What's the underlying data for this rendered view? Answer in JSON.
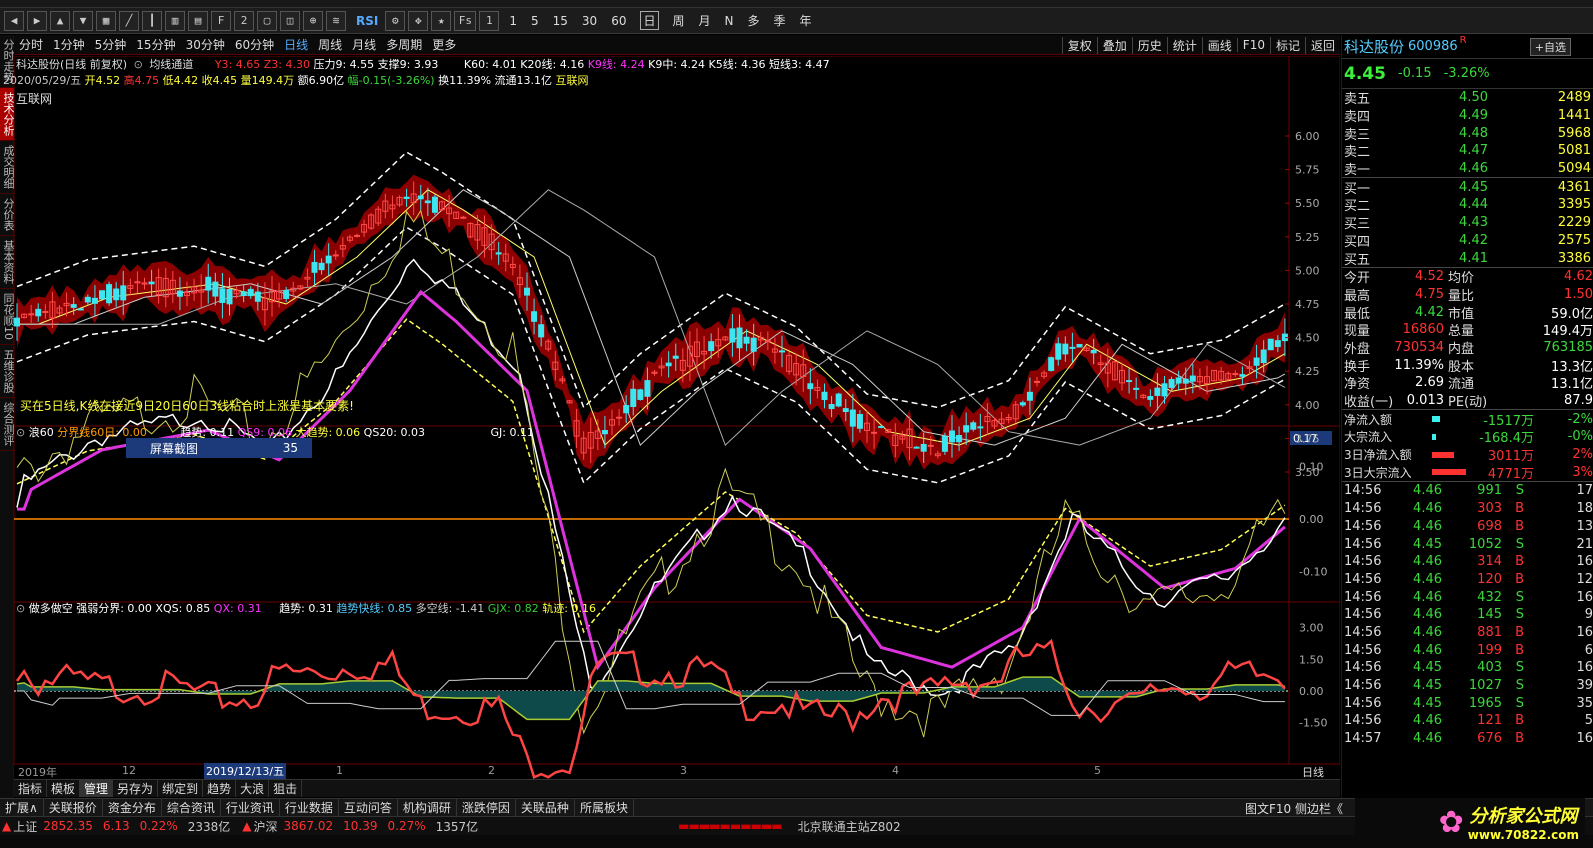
{
  "toolbar": {
    "periods": [
      "1",
      "5",
      "15",
      "30",
      "60"
    ],
    "day_tabs": [
      "日",
      "周",
      "月",
      "N",
      "多",
      "季",
      "年"
    ],
    "rsi": "RSI",
    "fs": "Fs"
  },
  "tabs": {
    "items": [
      "分时",
      "1分钟",
      "5分钟",
      "15分钟",
      "30分钟",
      "60分钟",
      "日线",
      "周线",
      "月线",
      "多周期",
      "更多"
    ],
    "active": "日线",
    "right": [
      "复权",
      "叠加",
      "历史",
      "统计",
      "画线",
      "F10",
      "标记",
      "返回"
    ]
  },
  "left_tabs": [
    "分时走势",
    "技术分析",
    "成交明细",
    "分价表",
    "基本资料",
    "同花顺10",
    "五维诊股",
    "综合测评"
  ],
  "main": {
    "title": "科达股份(日线 前复权)",
    "indicator_name": "均线通道",
    "y3": "Y3: 4.65",
    "z3": "Z3: 4.30",
    "yali": "压力9: 4.55",
    "zhicheng": "支撑9: 3.93",
    "k60": "K60: 4.01",
    "k20": "K20线: 4.16",
    "k9": "K9线: 4.24",
    "k9z": "K9中: 4.24",
    "k5": "K5线: 4.36",
    "dx": "短线3: 4.47",
    "date": "2020/05/29/五",
    "open": "开4.52",
    "high": "高4.75",
    "low": "低4.42",
    "close": "收4.45",
    "vol": "量149.4万",
    "amt": "额6.90亿",
    "chg": "幅-0.15(-3.26%)",
    "turn": "换11.39%",
    "flow": "流通13.1亿",
    "sector": "互联网",
    "label_net": "互联网",
    "note": "买在5日线,K线在接近9日20日60日3线粘合时上涨是基本要素!",
    "yticks": [
      "6.00",
      "5.75",
      "5.50",
      "5.25",
      "5.00",
      "4.75",
      "4.50",
      "4.25",
      "4.00",
      "3.75",
      "3.50"
    ]
  },
  "ind1": {
    "name": "浪60",
    "fjx": "分界线60日: 0.00",
    "qs": "趋势: 0.11",
    "qs9": "QS9: 0.06",
    "dqs": "大趋势: 0.06",
    "qs20": "QS20: 0.03",
    "gj": "GJ: 0.11",
    "current": "0.17",
    "yticks": [
      "0.10",
      "0.00",
      "-0.10"
    ],
    "popup_label": "屏幕截图",
    "popup_value": "35"
  },
  "ind2": {
    "name": "做多做空",
    "qrfj": "强弱分界: 0.00",
    "xqs": "XQS: 0.85",
    "qx": "QX: 0.31",
    "qs": "趋势: 0.31",
    "qskx": "趋势快线: 0.85",
    "dkx": "多空线: -1.41",
    "gjx": "GJX: 0.82",
    "gj": "轨迹: 0.16",
    "yticks": [
      "3.00",
      "1.50",
      "0.00",
      "-1.50"
    ]
  },
  "xaxis": {
    "labels": [
      "2019年",
      "12",
      "1",
      "2",
      "3",
      "4",
      "5"
    ],
    "highlight": "2019/12/13/五",
    "period": "日线"
  },
  "bottomtabs": {
    "items": [
      "指标",
      "模板",
      "管理",
      "另存为",
      "绑定到",
      "趋势",
      "大浪",
      "狙击"
    ],
    "active": "管理"
  },
  "bar2": {
    "items": [
      "扩展∧",
      "关联报价",
      "资金分布",
      "综合资讯",
      "行业资讯",
      "行业数据",
      "互动问答",
      "机构调研",
      "涨跌停因",
      "关联品种",
      "所属板块"
    ],
    "right": "图文F10 侧边栏《"
  },
  "status": {
    "sh_label": "上证",
    "sh_val": "2852.35",
    "sh_chg": "6.13",
    "sh_pct": "0.22%",
    "sh_amt": "2338亿",
    "sz_label": "沪深",
    "sz_val": "3867.02",
    "sz_chg": "10.39",
    "sz_pct": "0.27%",
    "sz_amt": "1357亿",
    "server": "北京联通主站Z802",
    "watermark": "分析家公式网",
    "watermark_url": "www.70822.com"
  },
  "side": {
    "name": "科达股份",
    "code": "600986",
    "r": "R",
    "add_btn": "+自选",
    "price": "4.45",
    "chg": "-0.15",
    "pct": "-3.26%",
    "asks": [
      {
        "l": "卖五",
        "p": "4.50",
        "v": "2489"
      },
      {
        "l": "卖四",
        "p": "4.49",
        "v": "1441"
      },
      {
        "l": "卖三",
        "p": "4.48",
        "v": "5968"
      },
      {
        "l": "卖二",
        "p": "4.47",
        "v": "5081"
      },
      {
        "l": "卖一",
        "p": "4.46",
        "v": "5094"
      }
    ],
    "bids": [
      {
        "l": "买一",
        "p": "4.45",
        "v": "4361"
      },
      {
        "l": "买二",
        "p": "4.44",
        "v": "3395"
      },
      {
        "l": "买三",
        "p": "4.43",
        "v": "2229"
      },
      {
        "l": "买四",
        "p": "4.42",
        "v": "2575"
      },
      {
        "l": "买五",
        "p": "4.41",
        "v": "3386"
      }
    ],
    "stats": [
      {
        "a": "今开",
        "av": "4.52",
        "b": "均价",
        "bv": "4.62"
      },
      {
        "a": "最高",
        "av": "4.75",
        "b": "量比",
        "bv": "1.50"
      },
      {
        "a": "最低",
        "av": "4.42",
        "b": "市值",
        "bv": "59.0亿"
      },
      {
        "a": "现量",
        "av": "16860",
        "b": "总量",
        "bv": "149.4万"
      },
      {
        "a": "外盘",
        "av": "730534",
        "b": "内盘",
        "bv": "763185"
      },
      {
        "a": "换手",
        "av": "11.39%",
        "b": "股本",
        "bv": "13.3亿"
      },
      {
        "a": "净资",
        "av": "2.69",
        "b": "流通",
        "bv": "13.1亿"
      },
      {
        "a": "收益(一)",
        "av": "0.013",
        "b": "PE(动)",
        "bv": "87.9"
      }
    ],
    "flows": [
      {
        "l": "净流入额",
        "v": "-1517万",
        "p": "-2%"
      },
      {
        "l": "大宗流入",
        "v": "-168.4万",
        "p": "-0%"
      },
      {
        "l": "3日净流入额",
        "v": "3011万",
        "p": "2%"
      },
      {
        "l": "3日大宗流入",
        "v": "4771万",
        "p": "3%"
      }
    ],
    "ticks": [
      {
        "t": "14:56",
        "p": "4.46",
        "v": "991",
        "s": "S",
        "n": "17"
      },
      {
        "t": "14:56",
        "p": "4.46",
        "v": "303",
        "s": "B",
        "n": "18"
      },
      {
        "t": "14:56",
        "p": "4.46",
        "v": "698",
        "s": "B",
        "n": "13"
      },
      {
        "t": "14:56",
        "p": "4.45",
        "v": "1052",
        "s": "S",
        "n": "21"
      },
      {
        "t": "14:56",
        "p": "4.46",
        "v": "314",
        "s": "B",
        "n": "16"
      },
      {
        "t": "14:56",
        "p": "4.46",
        "v": "120",
        "s": "B",
        "n": "12"
      },
      {
        "t": "14:56",
        "p": "4.46",
        "v": "432",
        "s": "S",
        "n": "16"
      },
      {
        "t": "14:56",
        "p": "4.46",
        "v": "145",
        "s": "S",
        "n": "9"
      },
      {
        "t": "14:56",
        "p": "4.46",
        "v": "881",
        "s": "B",
        "n": "16"
      },
      {
        "t": "14:56",
        "p": "4.46",
        "v": "199",
        "s": "B",
        "n": "6"
      },
      {
        "t": "14:56",
        "p": "4.45",
        "v": "403",
        "s": "S",
        "n": "16"
      },
      {
        "t": "14:56",
        "p": "4.45",
        "v": "1027",
        "s": "S",
        "n": "39"
      },
      {
        "t": "14:56",
        "p": "4.45",
        "v": "1965",
        "s": "S",
        "n": "35"
      },
      {
        "t": "14:56",
        "p": "4.46",
        "v": "121",
        "s": "B",
        "n": "5"
      },
      {
        "t": "14:57",
        "p": "4.46",
        "v": "676",
        "s": "B",
        "n": "16"
      }
    ]
  }
}
